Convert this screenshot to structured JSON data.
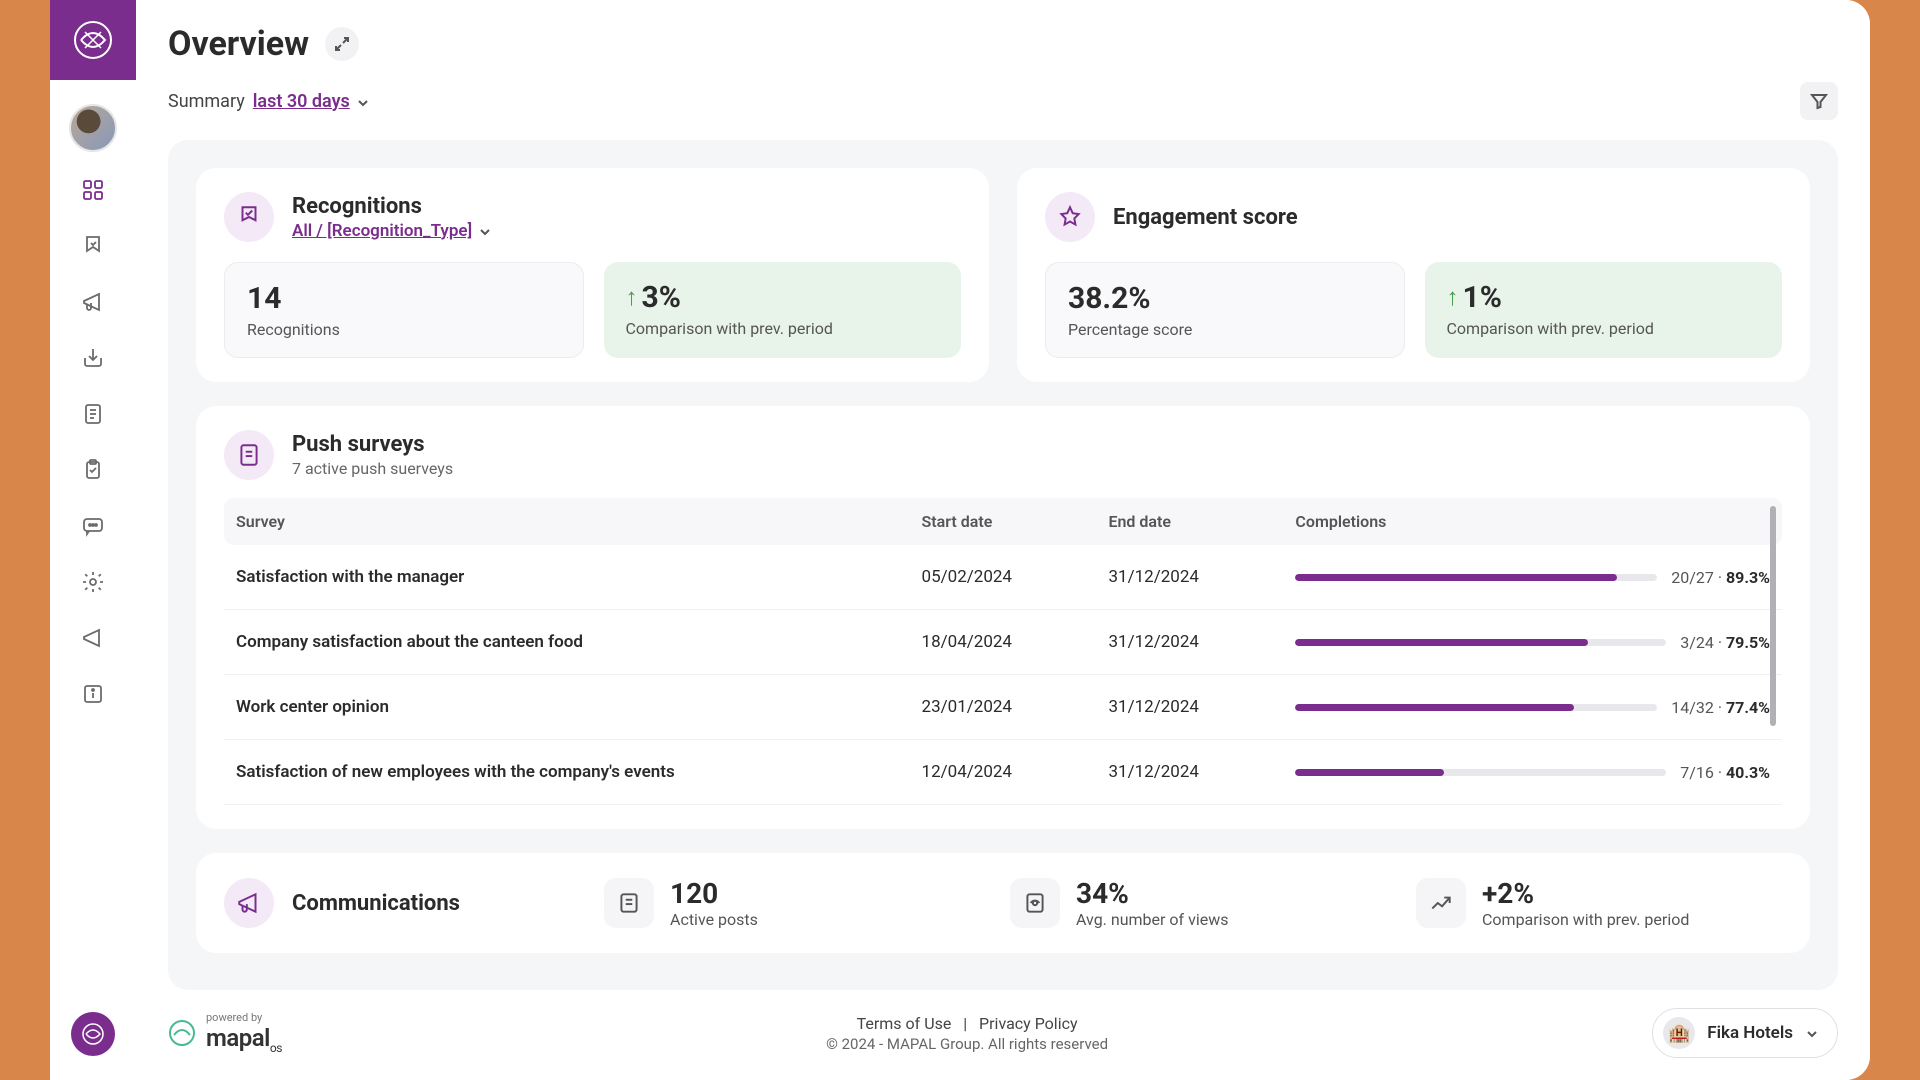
{
  "header": {
    "title": "Overview",
    "summary_label": "Summary",
    "period": "last 30 days"
  },
  "recognitions": {
    "title": "Recognitions",
    "filter": "All / [Recognition_Type]",
    "count": "14",
    "count_label": "Recognitions",
    "delta": "3%",
    "delta_label": "Comparison with prev. period"
  },
  "engagement": {
    "title": "Engagement score",
    "score": "38.2%",
    "score_label": "Percentage score",
    "delta": "1%",
    "delta_label": "Comparison with prev. period"
  },
  "surveys": {
    "title": "Push surveys",
    "subtitle": "7 active push suerveys",
    "columns": {
      "survey": "Survey",
      "start": "Start date",
      "end": "End date",
      "completions": "Completions"
    },
    "rows": [
      {
        "name": "Satisfaction with the manager",
        "start": "05/02/2024",
        "end": "31/12/2024",
        "ratio": "20/27",
        "pct": "89.3%",
        "fill": 89
      },
      {
        "name": "Company satisfaction about the canteen food",
        "start": "18/04/2024",
        "end": "31/12/2024",
        "ratio": "3/24",
        "pct": "79.5%",
        "fill": 79
      },
      {
        "name": "Work center opinion",
        "start": "23/01/2024",
        "end": "31/12/2024",
        "ratio": "14/32",
        "pct": "77.4%",
        "fill": 77
      },
      {
        "name": "Satisfaction of new employees with the company's events",
        "start": "12/04/2024",
        "end": "31/12/2024",
        "ratio": "7/16",
        "pct": "40.3%",
        "fill": 40
      }
    ]
  },
  "communications": {
    "title": "Communications",
    "posts": "120",
    "posts_label": "Active posts",
    "views": "34%",
    "views_label": "Avg. number of views",
    "delta": "+2%",
    "delta_label": "Comparison with prev. period"
  },
  "footer": {
    "powered": "powered by",
    "brand": "mapal",
    "brand_suffix": "os",
    "terms": "Terms of Use",
    "privacy": "Privacy Policy",
    "copyright": "© 2024 - MAPAL Group. All rights reserved",
    "org": "Fika Hotels"
  }
}
